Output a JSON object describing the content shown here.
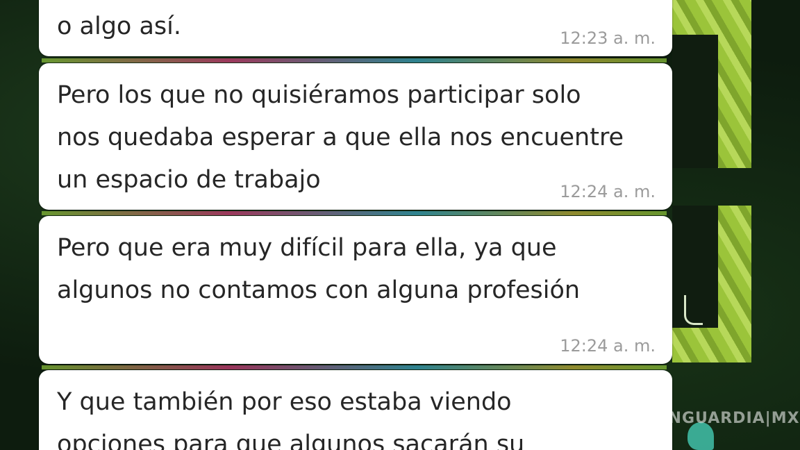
{
  "messages": [
    {
      "text": "o algo así.",
      "time": "12:23 a. m."
    },
    {
      "text": "Pero los que no quisiéramos participar solo nos quedaba esperar a que ella nos encuentre un espacio de trabajo",
      "time": "12:24 a. m."
    },
    {
      "text": "Pero que era muy difícil para ella, ya que algunos no contamos con alguna profesión",
      "time": "12:24 a. m."
    },
    {
      "text": "Y que también por eso estaba viendo opciones para que algunos sacarán su",
      "time": ""
    }
  ],
  "watermark": "VANGUARDIA|MX",
  "colors": {
    "bubble": "#ffffff",
    "text": "#262626",
    "time": "#9b9b9b",
    "wallpaper": "#0d1c0e",
    "deco_green": "#9bc43a"
  }
}
